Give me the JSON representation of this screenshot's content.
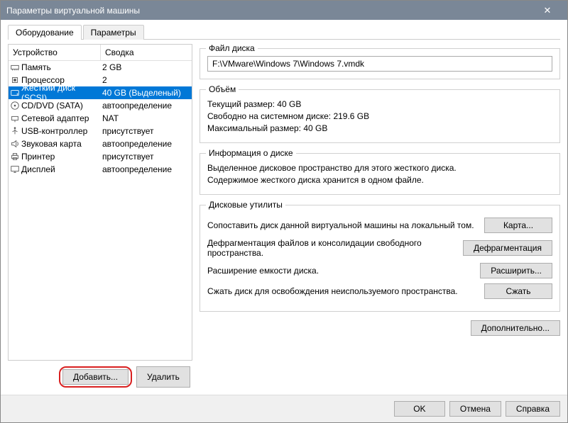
{
  "window": {
    "title": "Параметры виртуальной машины"
  },
  "tabs": {
    "hardware": "Оборудование",
    "options": "Параметры"
  },
  "headers": {
    "device": "Устройство",
    "summary": "Сводка"
  },
  "devices": [
    {
      "icon": "memory",
      "name": "Память",
      "summary": "2 GB"
    },
    {
      "icon": "cpu",
      "name": "Процессор",
      "summary": "2"
    },
    {
      "icon": "hdd",
      "name": "Жесткий диск (SCSI)",
      "summary": "40 GB (Выделеный)",
      "selected": true
    },
    {
      "icon": "cd",
      "name": "CD/DVD (SATA)",
      "summary": "автоопределение"
    },
    {
      "icon": "net",
      "name": "Сетевой адаптер",
      "summary": "NAT"
    },
    {
      "icon": "usb",
      "name": "USB-контроллер",
      "summary": "присутствует"
    },
    {
      "icon": "sound",
      "name": "Звуковая карта",
      "summary": "автоопределение"
    },
    {
      "icon": "printer",
      "name": "Принтер",
      "summary": "присутствует"
    },
    {
      "icon": "display",
      "name": "Дисплей",
      "summary": "автоопределение"
    }
  ],
  "buttons": {
    "add": "Добавить...",
    "remove": "Удалить"
  },
  "diskfile": {
    "legend": "Файл диска",
    "path": "F:\\VMware\\Windows 7\\Windows 7.vmdk"
  },
  "capacity": {
    "legend": "Объём",
    "current": "Текущий размер: 40 GB",
    "free": "Свободно на системном диске: 219.6 GB",
    "max": "Максимальный размер: 40 GB"
  },
  "diskinfo": {
    "legend": "Информация о диске",
    "line1": "Выделенное дисковое пространство для этого жесткого диска.",
    "line2": "Содержимое жесткого диска хранится в одном файле."
  },
  "utilities": {
    "legend": "Дисковые утилиты",
    "map_text": "Сопоставить диск данной виртуальной машины на локальный том.",
    "map_btn": "Карта...",
    "defrag_text": "Дефрагментация файлов и консолидации свободного пространства.",
    "defrag_btn": "Дефрагментация",
    "expand_text": "Расширение емкости диска.",
    "expand_btn": "Расширить...",
    "compact_text": "Сжать диск для освобождения неиспользуемого пространства.",
    "compact_btn": "Сжать"
  },
  "advanced": "Дополнительно...",
  "footer": {
    "ok": "OK",
    "cancel": "Отмена",
    "help": "Справка"
  }
}
